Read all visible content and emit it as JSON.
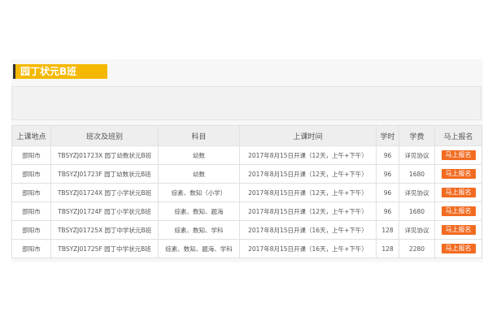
{
  "section": {
    "title": "园丁状元B班"
  },
  "table": {
    "headers": [
      "上课地点",
      "班次及班别",
      "科目",
      "上课时间",
      "学时",
      "学费",
      "马上报名"
    ],
    "rows": [
      {
        "location": "邵阳市",
        "class": "TBSYZJ01723X 园丁幼数状元B班",
        "subject": "幼数",
        "time": "2017年8月15日开课（12天，上午+下午）",
        "hours": "96",
        "fee": "详见协议",
        "action": "马上报名"
      },
      {
        "location": "邵阳市",
        "class": "TBSYZJ01723F 园丁幼数状元B班",
        "subject": "幼数",
        "time": "2017年8月15日开课（12天，上午+下午）",
        "hours": "96",
        "fee": "1680",
        "action": "马上报名"
      },
      {
        "location": "邵阳市",
        "class": "TBSYZJ01724X 园丁小学状元B班",
        "subject": "综素、数知（小学）",
        "time": "2017年8月15日开课（12天，上午+下午）",
        "hours": "96",
        "fee": "详见协议",
        "action": "马上报名"
      },
      {
        "location": "邵阳市",
        "class": "TBSYZJ01724F 园丁小学状元B班",
        "subject": "综素、数知、题海",
        "time": "2017年8月15日开课（12天，上午+下午）",
        "hours": "96",
        "fee": "1680",
        "action": "马上报名"
      },
      {
        "location": "邵阳市",
        "class": "TBSYZJ01725X 园丁中学状元B班",
        "subject": "综素、数知、学科",
        "time": "2017年8月15日开课（16天，上午+下午）",
        "hours": "128",
        "fee": "详见协议",
        "action": "马上报名"
      },
      {
        "location": "邵阳市",
        "class": "TBSYZJ01725F 园丁中学状元B班",
        "subject": "综素、数知、题海、学科",
        "time": "2017年8月15日开课（16天，上午+下午）",
        "hours": "128",
        "fee": "2280",
        "action": "马上报名"
      }
    ]
  },
  "colors": {
    "title_bar": "#f5b800",
    "signup_button": "#f26b21",
    "header_bg": "#eeeeee"
  }
}
